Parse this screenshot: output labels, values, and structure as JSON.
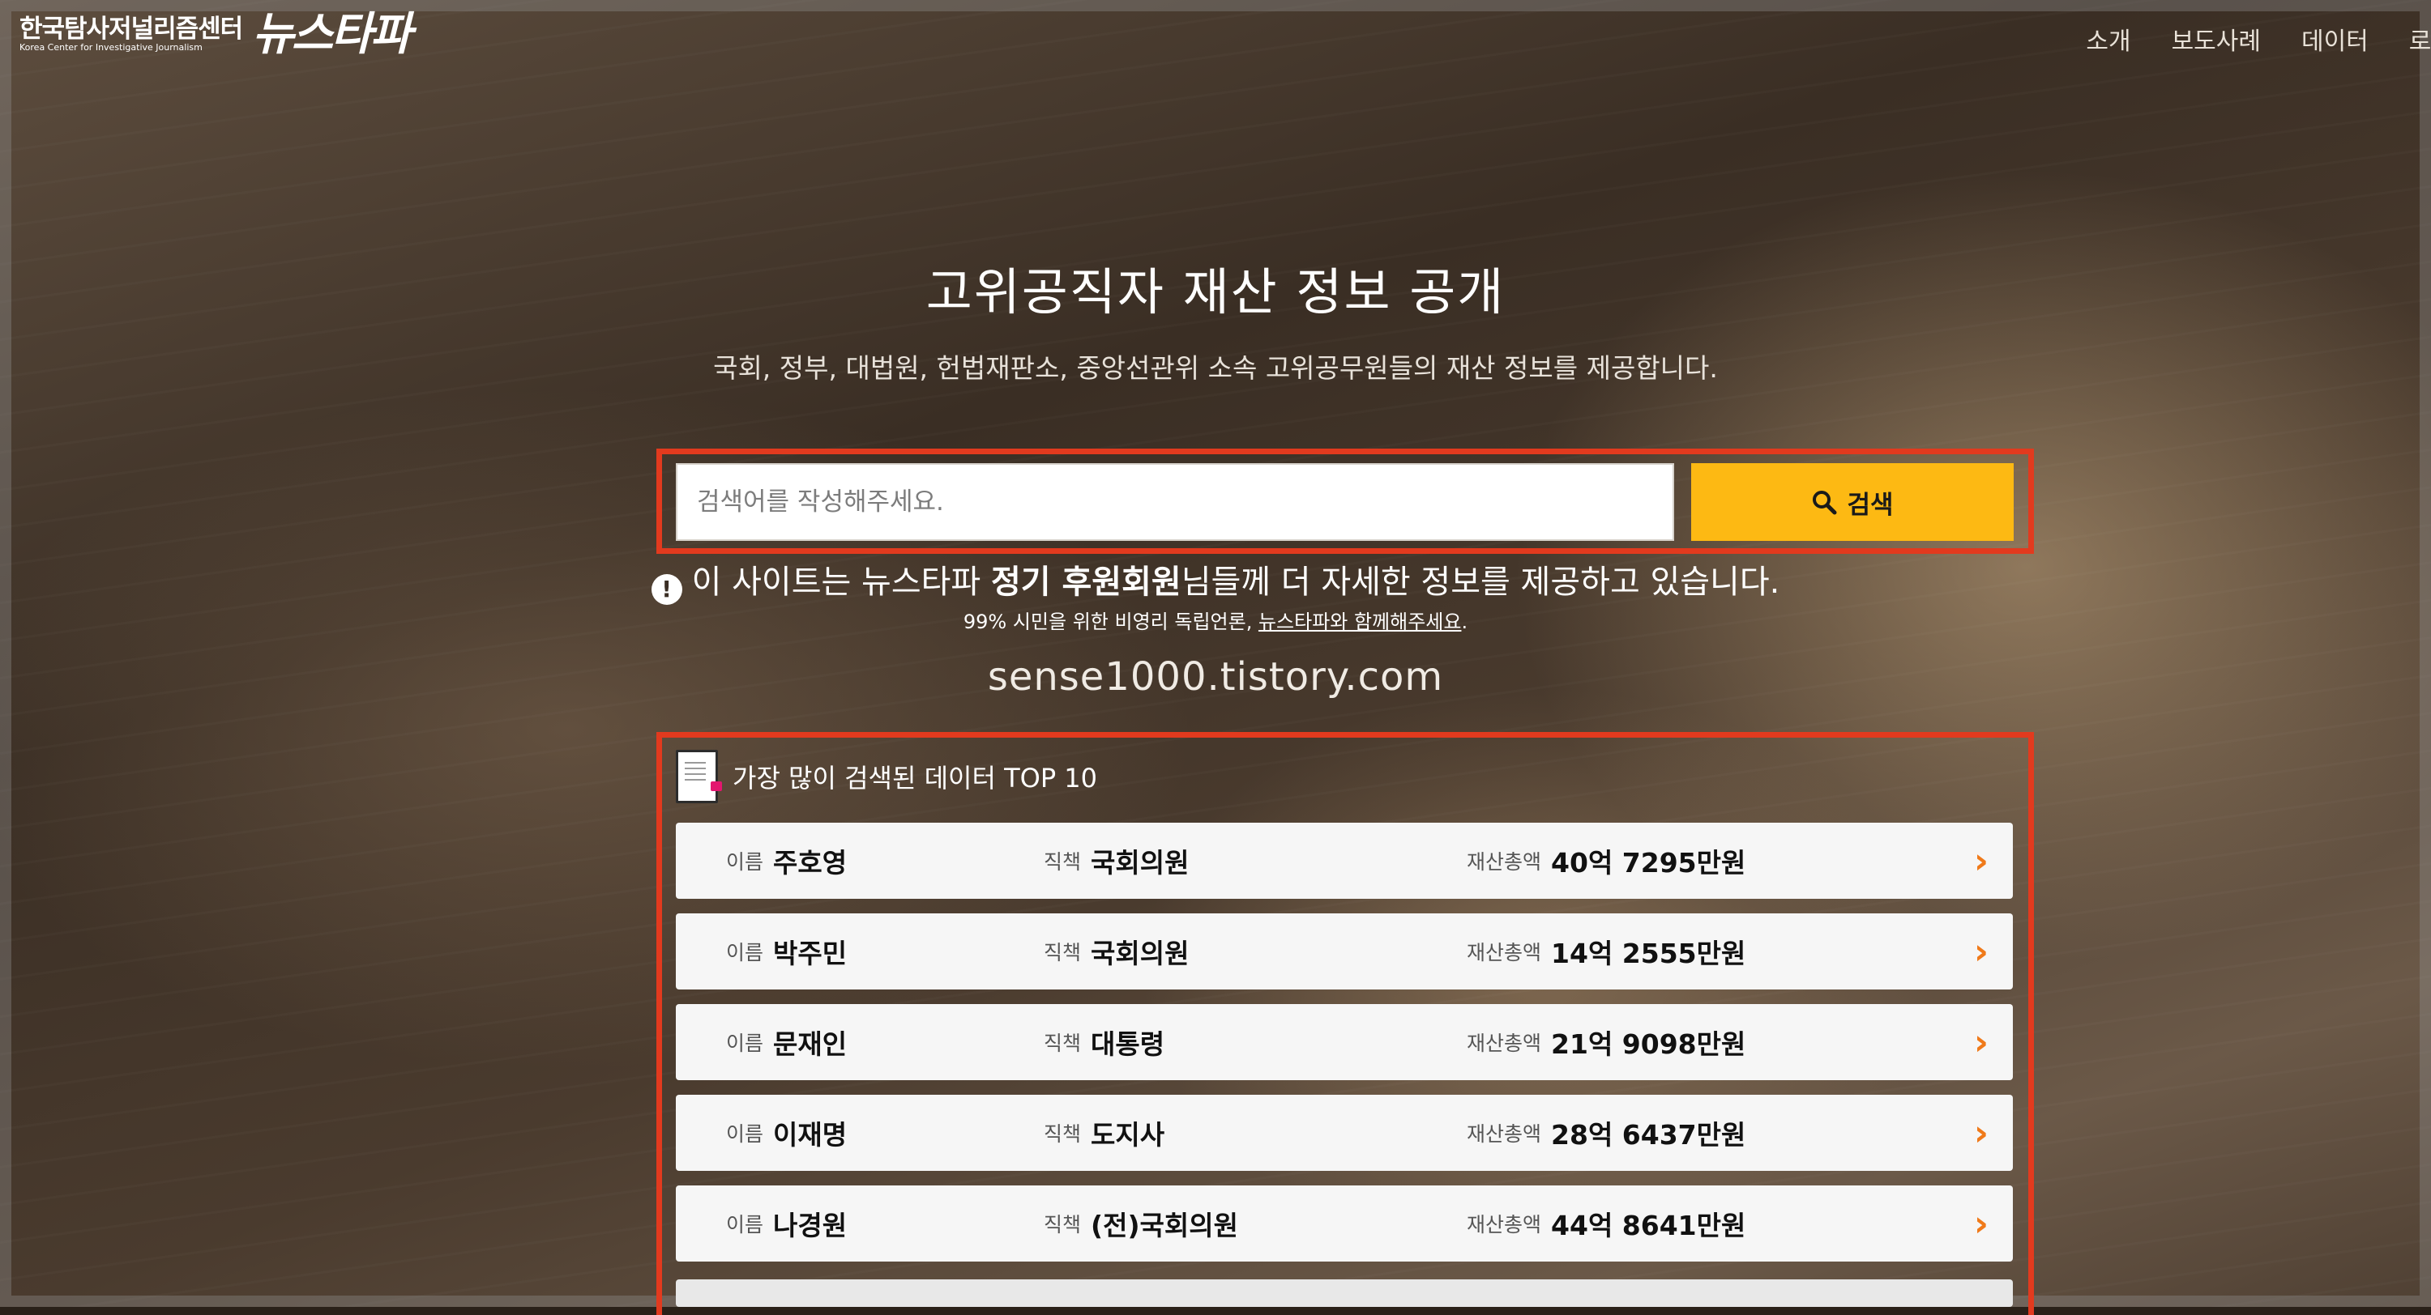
{
  "header": {
    "logo_korean": "한국탐사저널리즘센터",
    "logo_english": "Korea Center for Investigative Journalism",
    "logo_mark": "뉴스타파",
    "nav": [
      "소개",
      "보도사례",
      "데이터",
      "로그"
    ]
  },
  "hero": {
    "title": "고위공직자 재산 정보 공개",
    "subtitle": "국회, 정부, 대법원, 헌법재판소, 중앙선관위 소속 고위공무원들의 재산 정보를 제공합니다."
  },
  "search": {
    "placeholder": "검색어를 작성해주세요.",
    "button_label": "검색"
  },
  "notice": {
    "prefix": "이 사이트는 뉴스타파 ",
    "bold": "정기 후원회원",
    "suffix": "님들께 더 자세한 정보를 제공하고 있습니다.",
    "sub_text": "99% 시민을 위한 비영리 독립언론, ",
    "sub_link": "뉴스타파와 함께해주세요",
    "sub_end": "."
  },
  "watermark": "sense1000.tistory.com",
  "top10": {
    "title": "가장 많이 검색된 데이터 TOP 10",
    "labels": {
      "name": "이름",
      "position": "직책",
      "asset": "재산총액"
    },
    "rows": [
      {
        "name": "주호영",
        "position": "국회의원",
        "asset": "40억 7295만원"
      },
      {
        "name": "박주민",
        "position": "국회의원",
        "asset": "14억 2555만원"
      },
      {
        "name": "문재인",
        "position": "대통령",
        "asset": "21억 9098만원"
      },
      {
        "name": "이재명",
        "position": "도지사",
        "asset": "28억 6437만원"
      },
      {
        "name": "나경원",
        "position": "(전)국회의원",
        "asset": "44억 8641만원"
      }
    ]
  },
  "colors": {
    "accent": "#fdb913",
    "highlight_border": "#e23a1e",
    "chevron": "#f07a1a"
  }
}
